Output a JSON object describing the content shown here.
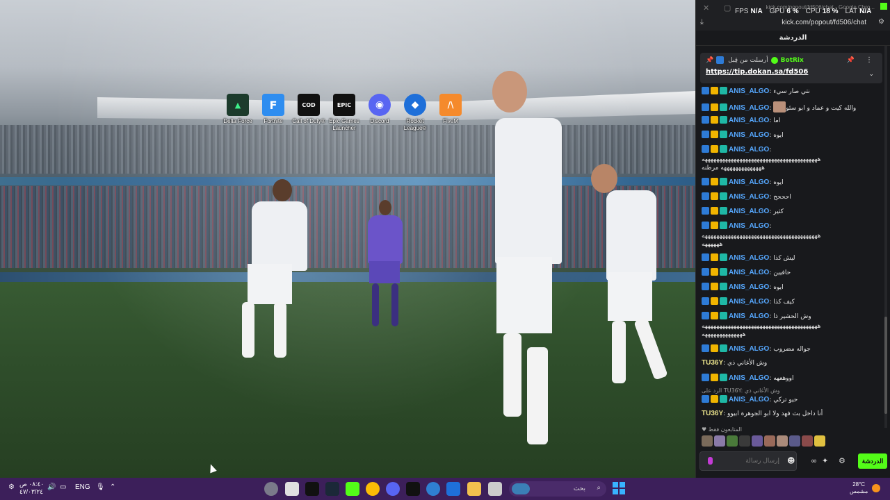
{
  "desktop": {
    "icons": [
      {
        "label": "Delta Force",
        "icon": "delta-force-icon",
        "color": "#1c3b2c"
      },
      {
        "label": "Fortnite",
        "icon": "fortnite-icon",
        "color": "#2e8df0"
      },
      {
        "label": "Call of Duty®",
        "icon": "call-of-duty-icon",
        "color": "#111111"
      },
      {
        "label": "Epic Games Launcher",
        "icon": "epic-games-icon",
        "color": "#111111"
      },
      {
        "label": "Discord",
        "icon": "discord-icon",
        "color": "#5865f2"
      },
      {
        "label": "Rocket League®",
        "icon": "rocket-league-icon",
        "color": "#1e6fd9"
      },
      {
        "label": "FiveM",
        "icon": "fivem-icon",
        "color": "#f58a2c"
      }
    ],
    "icon_glyphs": [
      "▲",
      "F",
      "COD",
      "EPIC",
      "◉",
      "◆",
      "/\\"
    ]
  },
  "window": {
    "title": "kick.com/popout/fd506/chat - Google Chro...",
    "url": "kick.com/popout/fd506/chat",
    "brand_color": "#53fc18"
  },
  "stats": {
    "fps_label": "FPS",
    "fps_value": "N/A",
    "gpu_label": "GPU",
    "gpu_value": "6 %",
    "cpu_label": "CPU",
    "cpu_value": "18 %",
    "lat_label": "LAT",
    "lat_value": "N/A"
  },
  "chat": {
    "header": "الدردشة",
    "pinned": {
      "sent_by": "أرسلت من قِبل",
      "bot_name": "BotRix",
      "link": "https://tip.dokan.sa/fd506"
    },
    "messages": [
      {
        "user": "ANIS_ALGO",
        "text": "نتي صار سيء"
      },
      {
        "user": "ANIS_ALGO",
        "text": "والله كيت و عماد و ابو سئو"
      },
      {
        "user": "ANIS_ALGO",
        "text": "اما"
      },
      {
        "user": "ANIS_ALGO",
        "text": "ايوه"
      },
      {
        "user": "ANIS_ALGO",
        "text": ""
      },
      {
        "user": "",
        "text": "ههههههههههههههههههههههههههههههههههههههههه"
      },
      {
        "user": "",
        "text": "ههههههههههههههه مرطنه"
      },
      {
        "user": "ANIS_ALGO",
        "text": "ايوه"
      },
      {
        "user": "ANIS_ALGO",
        "text": "احححح"
      },
      {
        "user": "ANIS_ALGO",
        "text": "كثير"
      },
      {
        "user": "ANIS_ALGO",
        "text": ""
      },
      {
        "user": "",
        "text": "ههههههههههههههههههههههههههههههههههههههههه"
      },
      {
        "user": "",
        "text": "ههههههه"
      },
      {
        "user": "ANIS_ALGO",
        "text": "ليش كذا"
      },
      {
        "user": "ANIS_ALGO",
        "text": "حافيين"
      },
      {
        "user": "ANIS_ALGO",
        "text": "ايوه"
      },
      {
        "user": "ANIS_ALGO",
        "text": "كيف كذا"
      },
      {
        "user": "ANIS_ALGO",
        "text": "وش الحشير ذا"
      },
      {
        "user": "",
        "text": "ههههههههههههههههههههههههههههههههههههههههه"
      },
      {
        "user": "",
        "text": "ههههههههههههههه"
      },
      {
        "user": "ANIS_ALGO",
        "text": "جواله مضروب"
      },
      {
        "user": "TU36Y",
        "text": "وش الأغاني ذي"
      },
      {
        "user": "ANIS_ALGO",
        "text": "اووهعهه"
      },
      {
        "user": "",
        "text": "الرد على TU36Y: وش الأغاني ذي"
      },
      {
        "user": "ANIS_ALGO",
        "text": "حيو تركي"
      },
      {
        "user": "TU36Y",
        "text": "أنا داخل بث فهد ولا ابو الجوهرة ابيوو"
      }
    ],
    "watchers_label": "المتابعون فقط",
    "input_placeholder": "إرسال رسالة",
    "send_label": "الدردشة"
  },
  "taskbar": {
    "time": "٠٨:٤٠ ص",
    "date": "٤٧/٠٣/٢٤",
    "lang": "ENG",
    "search_placeholder": "بحث",
    "weather_temp": "28°C",
    "weather_text": "مشمس"
  }
}
